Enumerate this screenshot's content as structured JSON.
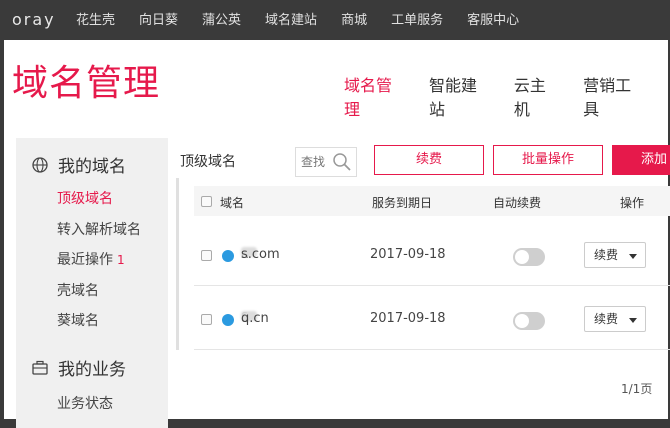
{
  "topbar": {
    "logo": "oray",
    "nav": [
      "花生壳",
      "向日葵",
      "蒲公英",
      "域名建站",
      "商城",
      "工单服务",
      "客服中心"
    ]
  },
  "header": {
    "title": "域名管理",
    "nav": [
      {
        "label": "域名管理",
        "active": true
      },
      {
        "label": "智能建站",
        "active": false
      },
      {
        "label": "云主机",
        "active": false
      },
      {
        "label": "营销工具",
        "active": false
      }
    ]
  },
  "sidebar": {
    "section1": {
      "title": "我的域名",
      "icon": "globe-icon"
    },
    "items": [
      {
        "label": "顶级域名",
        "active": true
      },
      {
        "label": "转入解析域名"
      },
      {
        "label": "最近操作",
        "badge": "1"
      },
      {
        "label": "壳域名"
      },
      {
        "label": "葵域名"
      }
    ],
    "section2": {
      "title": "我的业务",
      "icon": "briefcase-icon"
    },
    "items2": [
      {
        "label": "业务状态"
      }
    ]
  },
  "content": {
    "label": "顶级域名",
    "search_placeholder": "查找",
    "renew_button": "续费",
    "batch_button": "批量操作",
    "add_button": "添加"
  },
  "table": {
    "columns": [
      "域名",
      "服务到期日",
      "自动续费",
      "操作"
    ],
    "rows": [
      {
        "domain_prefix": "a",
        "domain_suffix": "s.com",
        "expiry": "2017-09-18",
        "auto_renew": false,
        "action": "续费"
      },
      {
        "domain_prefix": "8",
        "domain_suffix": "q.cn",
        "expiry": "2017-09-18",
        "auto_renew": false,
        "action": "续费"
      }
    ]
  },
  "pager": "1/1页",
  "colors": {
    "accent": "#e6194b",
    "topbar": "#3a3a3a",
    "sidebar": "#f0f0f0",
    "globe": "#2b9ae0"
  }
}
